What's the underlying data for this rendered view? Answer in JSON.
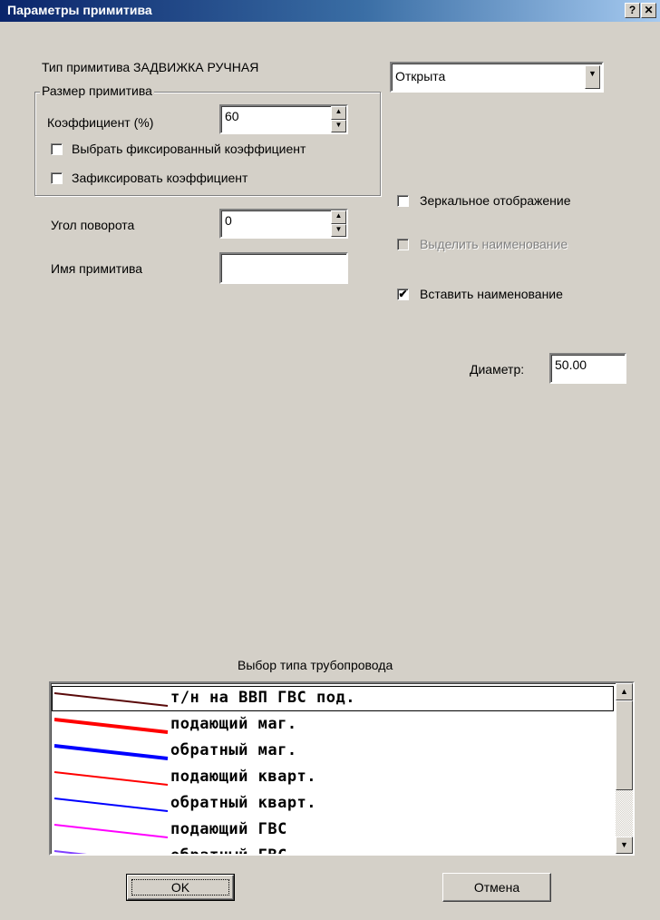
{
  "window": {
    "title": "Параметры примитива",
    "help_glyph": "?",
    "close_glyph": "✕"
  },
  "primitive": {
    "type_label": "Тип примитива ЗАДВИЖКА РУЧНАЯ",
    "size_group_label": "Размер примитива",
    "coef_label": "Коэффициент (%)",
    "coef_value": "60",
    "choose_fixed_label": "Выбрать фиксированный коэффициент",
    "choose_fixed_checked": false,
    "fix_coef_label": "Зафиксировать коэффициент",
    "fix_coef_checked": false,
    "angle_label": "Угол поворота",
    "angle_value": "0",
    "name_label": "Имя примитива",
    "name_value": ""
  },
  "state_select": {
    "value": "Открыта"
  },
  "options": {
    "mirror_label": "Зеркальное отображение",
    "mirror_checked": false,
    "highlight_name_label": "Выделить наименование",
    "highlight_name_checked": false,
    "highlight_name_disabled": true,
    "insert_name_label": "Вставить наименование",
    "insert_name_checked": true,
    "check_glyph": "✔"
  },
  "diameter": {
    "label": "Диаметр:",
    "value": "50.00"
  },
  "pipeline": {
    "title": "Выбор типа трубопровода",
    "items": [
      {
        "label": "т/н на ВВП ГВС под.",
        "color": "#5a0a0a",
        "width": 2,
        "selected": true
      },
      {
        "label": "подающий маг.",
        "color": "#ff0000",
        "width": 4,
        "selected": false
      },
      {
        "label": "обратный маг.",
        "color": "#0000ff",
        "width": 4,
        "selected": false
      },
      {
        "label": "подающий кварт.",
        "color": "#ff0000",
        "width": 2,
        "selected": false
      },
      {
        "label": "обратный кварт.",
        "color": "#0000ff",
        "width": 2,
        "selected": false
      },
      {
        "label": "подающий ГВС",
        "color": "#ff00ff",
        "width": 2,
        "selected": false
      },
      {
        "label": "обратный ГВС",
        "color": "#8040ff",
        "width": 2,
        "selected": false
      }
    ],
    "scroll_up_glyph": "▲",
    "scroll_down_glyph": "▼"
  },
  "buttons": {
    "ok_label": "OK",
    "cancel_label": "Отмена"
  }
}
